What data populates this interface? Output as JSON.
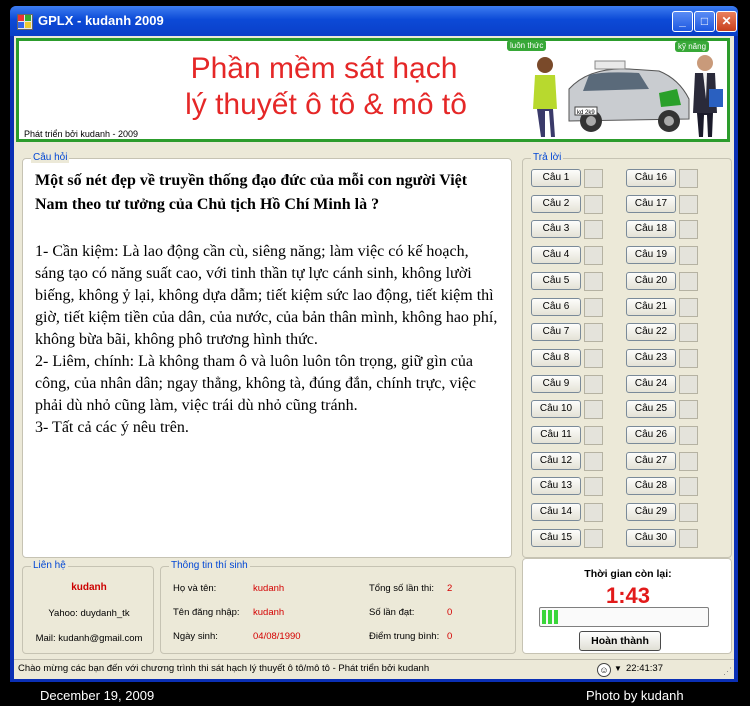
{
  "window": {
    "title": "GPLX - kudanh 2009",
    "controls": {
      "minimize": "_",
      "maximize": "□",
      "close": "✕"
    }
  },
  "banner": {
    "headline_1": "Phần mềm sát hạch",
    "headline_2": "lý thuyết ô tô & mô tô",
    "credit": "Phát triển bởi kudanh - 2009",
    "tag_left": "luôn thức",
    "tag_right": "kỹ năng",
    "plate": "kd 2k9"
  },
  "question": {
    "legend": "Câu hỏi",
    "title": "Một số nét đẹp về truyền thống đạo đức của mỗi con người Việt Nam  theo tư tưởng của Chủ tịch Hồ Chí Minh là ?",
    "options": [
      "1- Cần kiệm: Là lao động cần cù, siêng năng; làm việc có kế hoạch, sáng tạo có năng suất cao, với tinh thần tự lực cánh sinh, không lười biếng, không ỷ lại, không dựa dẫm; tiết kiệm sức lao động, tiết kiệm thì giờ, tiết kiệm tiền của dân, của nước, của bản thân mình, không hao phí, không bừa bãi, không phô trương hình thức.",
      "2- Liêm, chính: Là không tham ô và luôn luôn tôn trọng, giữ gìn của công, của nhân dân; ngay thẳng, không tà, đúng đắn, chính trực, việc phải dù nhỏ cũng làm, việc trái dù nhỏ cũng tránh.",
      "3- Tất cả các ý nêu trên."
    ]
  },
  "answers": {
    "legend": "Trả lời",
    "buttons": [
      "Câu 1",
      "Câu 2",
      "Câu 3",
      "Câu 4",
      "Câu 5",
      "Câu 6",
      "Câu 7",
      "Câu 8",
      "Câu 9",
      "Câu 10",
      "Câu 11",
      "Câu 12",
      "Câu 13",
      "Câu 14",
      "Câu 15",
      "Câu 16",
      "Câu 17",
      "Câu 18",
      "Câu 19",
      "Câu 20",
      "Câu 21",
      "Câu 22",
      "Câu 23",
      "Câu 24",
      "Câu 25",
      "Câu 26",
      "Câu 27",
      "Câu 28",
      "Câu 29",
      "Câu 30"
    ]
  },
  "contact": {
    "legend": "Liên hệ",
    "name": "kudanh",
    "yahoo": "Yahoo: duydanh_tk",
    "mail": "Mail: kudanh@gmail.com"
  },
  "candidate": {
    "legend": "Thông tin thí sinh",
    "full_name_label": "Họ và tên:",
    "full_name": "kudanh",
    "login_label": "Tên đăng nhập:",
    "login": "kudanh",
    "dob_label": "Ngày sinh:",
    "dob": "04/08/1990",
    "attempts_label": "Tổng số lần thi:",
    "attempts": "2",
    "passed_label": "Số lần đạt:",
    "passed": "0",
    "avg_label": "Điểm trung bình:",
    "avg": "0"
  },
  "timer": {
    "label": "Thời gian còn lại:",
    "value": "1:43",
    "progress_fraction": 0.12,
    "finish_label": "Hoàn thành"
  },
  "statusbar": {
    "message": "Chào mừng các bạn đến với chương trình thi sát hạch lý thuyết ô tô/mô tô - Phát triển bởi kudanh",
    "clock": "22:41:37"
  },
  "photo_caption": {
    "date": "December 19, 2009",
    "credit": "Photo by kudanh"
  },
  "colors": {
    "title_bar": "#0c4ad7",
    "banner_text": "#e52727",
    "accent_red": "#d40000",
    "progress_green": "#3ad63a",
    "banner_border": "#2c9c2c"
  }
}
